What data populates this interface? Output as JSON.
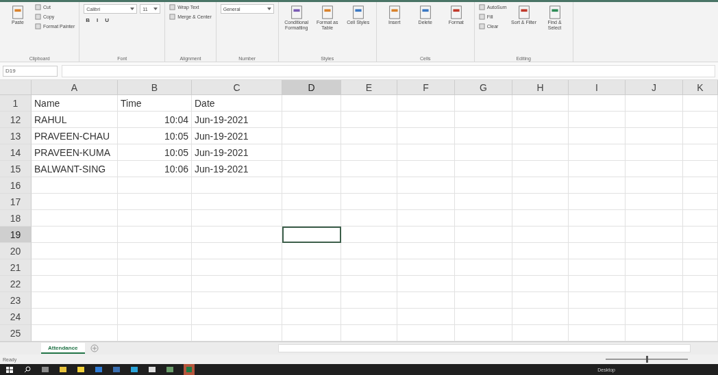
{
  "ribbon": {
    "groups": [
      {
        "label": "Clipboard",
        "items": [
          {
            "kind": "large",
            "label": "Paste"
          },
          {
            "kind": "stack",
            "lines": [
              [
                {
                  "kind": "small",
                  "label": "Cut"
                }
              ],
              [
                {
                  "kind": "small",
                  "label": "Copy"
                }
              ],
              [
                {
                  "kind": "small",
                  "label": "Format Painter"
                }
              ]
            ]
          }
        ]
      },
      {
        "label": "Font",
        "items": [
          {
            "kind": "stack",
            "lines": [
              [
                {
                  "kind": "dropdown",
                  "label": "Calibri"
                },
                {
                  "kind": "dropdown",
                  "label": "11"
                }
              ],
              [
                {
                  "kind": "glyph",
                  "label": "B"
                },
                {
                  "kind": "glyph",
                  "label": "I"
                },
                {
                  "kind": "glyph",
                  "label": "U"
                }
              ]
            ]
          }
        ]
      },
      {
        "label": "Alignment",
        "items": [
          {
            "kind": "stack",
            "lines": [
              [
                {
                  "kind": "small",
                  "label": "Wrap Text"
                }
              ],
              [
                {
                  "kind": "small",
                  "label": "Merge & Center"
                }
              ]
            ]
          }
        ]
      },
      {
        "label": "Number",
        "items": [
          {
            "kind": "stack",
            "lines": [
              [
                {
                  "kind": "dropdown",
                  "label": "General"
                }
              ]
            ]
          }
        ]
      },
      {
        "label": "Styles",
        "items": [
          {
            "kind": "large",
            "label": "Conditional Formatting"
          },
          {
            "kind": "large",
            "label": "Format as Table"
          },
          {
            "kind": "large",
            "label": "Cell Styles"
          }
        ]
      },
      {
        "label": "Cells",
        "items": [
          {
            "kind": "large",
            "label": "Insert"
          },
          {
            "kind": "large",
            "label": "Delete"
          },
          {
            "kind": "large",
            "label": "Format"
          }
        ]
      },
      {
        "label": "Editing",
        "items": [
          {
            "kind": "stack",
            "lines": [
              [
                {
                  "kind": "small",
                  "label": "AutoSum"
                }
              ],
              [
                {
                  "kind": "small",
                  "label": "Fill"
                }
              ],
              [
                {
                  "kind": "small",
                  "label": "Clear"
                }
              ]
            ]
          },
          {
            "kind": "large",
            "label": "Sort & Filter"
          },
          {
            "kind": "large",
            "label": "Find & Select"
          }
        ]
      }
    ]
  },
  "formula_bar": {
    "name_box": "D19"
  },
  "columns": [
    {
      "label": "A",
      "selected": false
    },
    {
      "label": "B",
      "selected": false
    },
    {
      "label": "C",
      "selected": false
    },
    {
      "label": "D",
      "selected": true
    },
    {
      "label": "E",
      "selected": false
    },
    {
      "label": "F",
      "selected": false
    },
    {
      "label": "G",
      "selected": false
    },
    {
      "label": "H",
      "selected": false
    },
    {
      "label": "I",
      "selected": false
    },
    {
      "label": "J",
      "selected": false
    },
    {
      "label": "K",
      "selected": false
    }
  ],
  "rows": [
    {
      "number": "1",
      "selected": false,
      "kind": "heading",
      "cells": [
        "Name",
        "Time",
        "Date"
      ]
    },
    {
      "number": "12",
      "selected": false,
      "kind": "entry",
      "cells": [
        "RAHUL",
        "10:04",
        "Jun-19-2021"
      ]
    },
    {
      "number": "13",
      "selected": false,
      "kind": "entry",
      "cells": [
        "PRAVEEN-CHAU",
        "10:05",
        "Jun-19-2021"
      ]
    },
    {
      "number": "14",
      "selected": false,
      "kind": "entry",
      "cells": [
        "PRAVEEN-KUMA",
        "10:05",
        "Jun-19-2021"
      ]
    },
    {
      "number": "15",
      "selected": false,
      "kind": "entry",
      "cells": [
        "BALWANT-SING",
        "10:06",
        "Jun-19-2021"
      ]
    },
    {
      "number": "16",
      "selected": false
    },
    {
      "number": "17",
      "selected": false
    },
    {
      "number": "18",
      "selected": false
    },
    {
      "number": "19",
      "selected": true
    },
    {
      "number": "20",
      "selected": false
    },
    {
      "number": "21",
      "selected": false
    },
    {
      "number": "22",
      "selected": false
    },
    {
      "number": "23",
      "selected": false
    },
    {
      "number": "24",
      "selected": false
    },
    {
      "number": "25",
      "selected": false
    }
  ],
  "sheet_tabs": [
    {
      "label": "Attendance",
      "selected": true
    }
  ],
  "status_bar": {
    "text": "Ready",
    "zoom": {
      "level": 0.5
    }
  },
  "taskbar": {
    "tray_label": "Desktop"
  }
}
